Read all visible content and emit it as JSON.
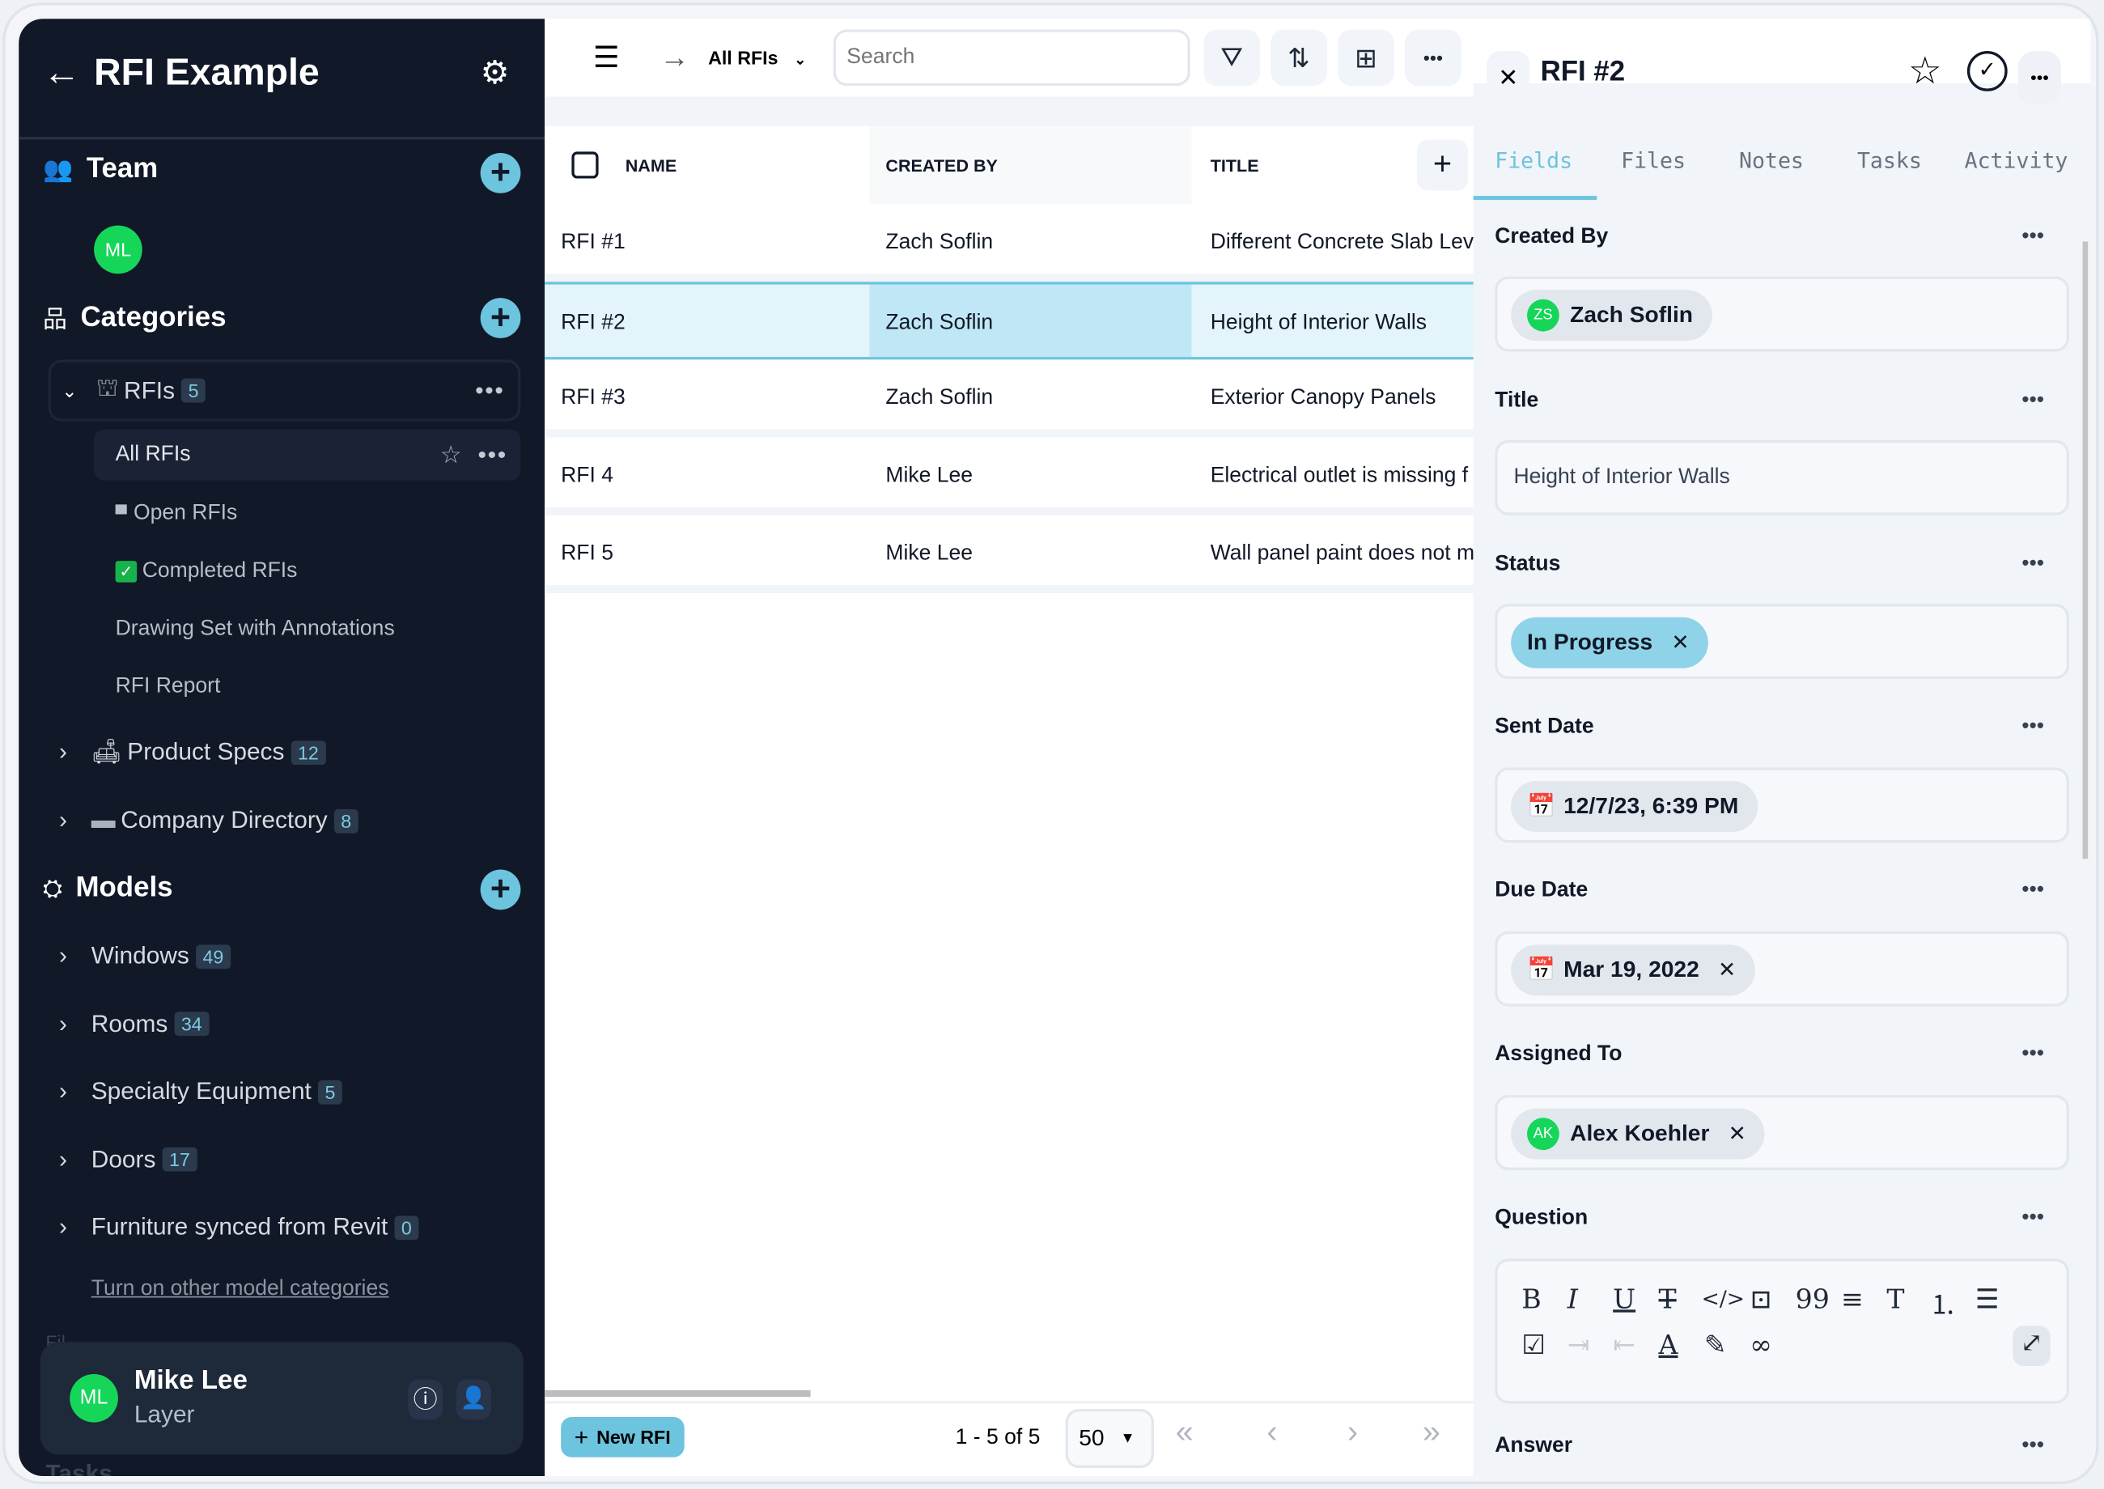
{
  "colors": {
    "sidebar_bg": "#111827",
    "accent": "#6cc4de",
    "avatar_green": "#16d65a",
    "selected_row": "#e3f4fb"
  },
  "sidebar": {
    "title": "RFI Example",
    "team": {
      "label": "Team",
      "members": [
        {
          "initials": "ML"
        }
      ]
    },
    "categories": {
      "label": "Categories",
      "items": [
        {
          "label": "RFIs",
          "count": "5",
          "expanded": true,
          "children": [
            {
              "label": "All RFIs",
              "selected": true
            },
            {
              "label": "Open RFIs"
            },
            {
              "label": "Completed RFIs"
            },
            {
              "label": "Drawing Set with Annotations"
            },
            {
              "label": "RFI Report"
            }
          ]
        },
        {
          "label": "Product Specs",
          "count": "12"
        },
        {
          "label": "Company Directory",
          "count": "8"
        }
      ]
    },
    "models": {
      "label": "Models",
      "items": [
        {
          "label": "Windows",
          "count": "49"
        },
        {
          "label": "Rooms",
          "count": "34"
        },
        {
          "label": "Specialty Equipment",
          "count": "5"
        },
        {
          "label": "Doors",
          "count": "17"
        },
        {
          "label": "Furniture synced from Revit",
          "count": "0"
        }
      ],
      "link": "Turn on other model categories"
    },
    "hidden_sections": [
      "Fil",
      "Tasks"
    ],
    "user": {
      "initials": "ML",
      "name": "Mike Lee",
      "org": "Layer"
    }
  },
  "toolbar": {
    "view": "All RFIs",
    "search_placeholder": "Search"
  },
  "table": {
    "columns": [
      "NAME",
      "CREATED BY",
      "TITLE"
    ],
    "rows": [
      [
        "RFI #1",
        "Zach Soflin",
        "Different Concrete Slab Lev"
      ],
      [
        "RFI #2",
        "Zach Soflin",
        "Height of Interior Walls"
      ],
      [
        "RFI #3",
        "Zach Soflin",
        "Exterior Canopy Panels"
      ],
      [
        "RFI 4",
        "Mike Lee",
        "Electrical outlet is missing f"
      ],
      [
        "RFI 5",
        "Mike Lee",
        "Wall panel paint does not m"
      ]
    ],
    "selected_row": 1
  },
  "footer": {
    "new_button": "New RFI",
    "range": "1 - 5 of 5",
    "page_size": "50"
  },
  "panel": {
    "title": "RFI #2",
    "tabs": [
      "Fields",
      "Files",
      "Notes",
      "Tasks",
      "Activity"
    ],
    "active_tab": "Fields",
    "fields": {
      "created_by": {
        "label": "Created By",
        "initials": "ZS",
        "value": "Zach Soflin"
      },
      "title": {
        "label": "Title",
        "value": "Height of Interior Walls"
      },
      "status": {
        "label": "Status",
        "value": "In Progress"
      },
      "sent_date": {
        "label": "Sent Date",
        "value": "12/7/23, 6:39 PM"
      },
      "due_date": {
        "label": "Due Date",
        "value": "Mar 19, 2022"
      },
      "assigned_to": {
        "label": "Assigned To",
        "initials": "AK",
        "value": "Alex Koehler"
      },
      "question": {
        "label": "Question"
      },
      "answer": {
        "label": "Answer"
      }
    }
  }
}
